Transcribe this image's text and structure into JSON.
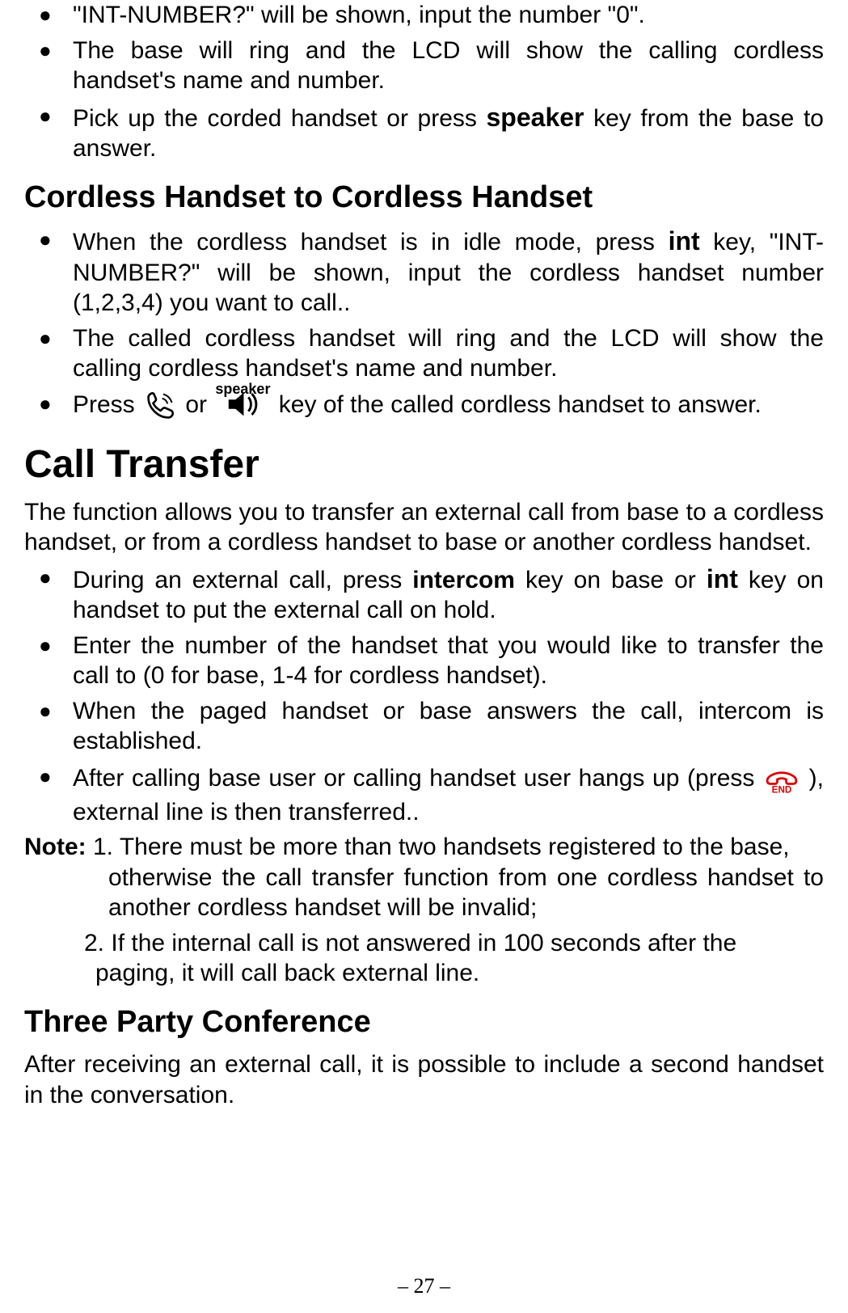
{
  "top_bullets": [
    {
      "pre": "\"INT-NUMBER?\" will be shown, input the number \"0\"."
    },
    {
      "pre": "The base will ring and the LCD will show the calling cordless handset's name and number."
    },
    {
      "pre": "Pick up the corded handset or press ",
      "key": "speaker",
      "post": " key from the base to answer."
    }
  ],
  "section_cordless": "Cordless Handset to Cordless Handset",
  "cordless_bullets": {
    "b1_pre": "When the cordless handset is in idle mode, press ",
    "b1_key": "int",
    "b1_post": " key, \"INT-NUMBER?\" will be shown, input the cordless handset number (1,2,3,4) you want to call..",
    "b2": "The called cordless handset will ring and the LCD will show the calling cordless handset's name and number.",
    "b3_pre": "Press  ",
    "b3_mid": " or ",
    "b3_spk_label": "speaker",
    "b3_post": "  key of the called cordless handset to answer."
  },
  "section_transfer": "Call Transfer",
  "transfer_para": "The function allows you to transfer an external call from base to a cordless handset, or from a cordless handset to base or another cordless handset.",
  "transfer_bullets": {
    "b1_pre": "During an external call, press ",
    "b1_key1": "intercom",
    "b1_mid": " key on base or ",
    "b1_key2": "int",
    "b1_post": " key on handset to put the external call on hold.",
    "b2": "Enter the number of the handset that you would like to transfer the call to (0 for base, 1-4 for cordless handset).",
    "b3": "When the paged handset or base answers the call, intercom is established.",
    "b4_pre": "After calling base user or calling handset user hangs up (press ",
    "b4_end": "END",
    "b4_post": "),   external line is then transferred.."
  },
  "note": {
    "label": "Note: ",
    "n1a": "1. There must be more than two handsets registered to the base, ",
    "n1b": "otherwise the call transfer function from one cordless handset to another cordless handset will be invalid;",
    "n2a": "2. If the internal call is not answered in 100 seconds after the ",
    "n2b": "paging, it will call back external line."
  },
  "section_conf": "Three Party Conference",
  "conf_para": "After receiving an external call, it is possible to include a second handset in the conversation.",
  "page_number": "– 27 –"
}
